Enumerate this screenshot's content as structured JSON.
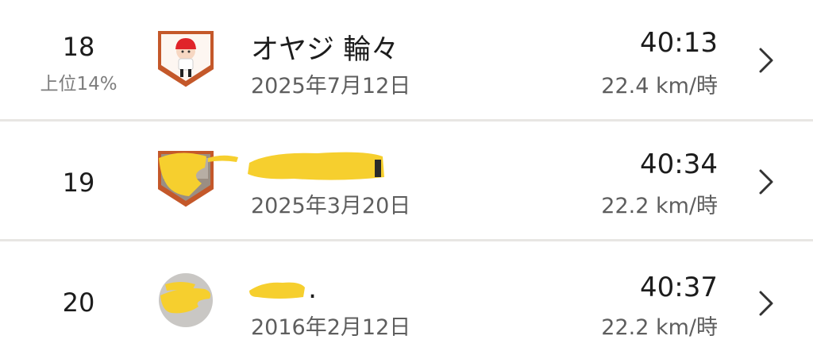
{
  "leaderboard": {
    "entries": [
      {
        "rank": "18",
        "percentile": "上位14%",
        "name": "オヤジ 輪々",
        "date": "2025年7月12日",
        "time": "40:13",
        "speed": "22.4 km/時",
        "badge_icon": "cartoon-rider-avatar-shield"
      },
      {
        "rank": "19",
        "name": "",
        "date": "2025年3月20日",
        "time": "40:34",
        "speed": "22.2 km/時",
        "badge_icon": "photo-avatar-shield"
      },
      {
        "rank": "20",
        "name": ".",
        "date": "2016年2月12日",
        "time": "40:37",
        "speed": "22.2 km/時",
        "badge_icon": "round-photo-avatar"
      }
    ]
  },
  "colors": {
    "background": "#ffffff",
    "divider": "#e8e6e3",
    "badge_orange": "#c4582a",
    "redaction_yellow": "#f6cf2e"
  }
}
